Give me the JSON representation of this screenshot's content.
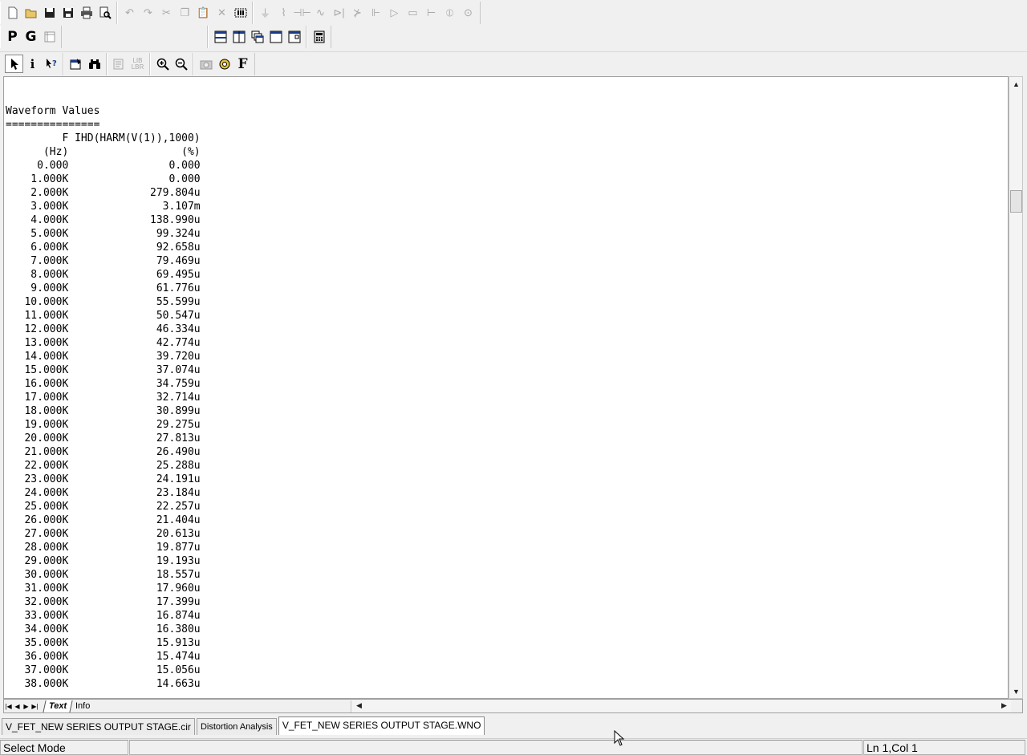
{
  "toolbar": {
    "chars": {
      "p_button": "P",
      "g_button": "G",
      "f_button": "F"
    }
  },
  "document": {
    "title_line": "Waveform Values",
    "underline": "===============",
    "header_row1": "         F IHD(HARM(V(1)),1000)",
    "header_row2": "      (Hz)                  (%)",
    "rows": [
      {
        "f": "0.000",
        "v": "0.000"
      },
      {
        "f": "1.000K",
        "v": "0.000"
      },
      {
        "f": "2.000K",
        "v": "279.804u"
      },
      {
        "f": "3.000K",
        "v": "3.107m"
      },
      {
        "f": "4.000K",
        "v": "138.990u"
      },
      {
        "f": "5.000K",
        "v": "99.324u"
      },
      {
        "f": "6.000K",
        "v": "92.658u"
      },
      {
        "f": "7.000K",
        "v": "79.469u"
      },
      {
        "f": "8.000K",
        "v": "69.495u"
      },
      {
        "f": "9.000K",
        "v": "61.776u"
      },
      {
        "f": "10.000K",
        "v": "55.599u"
      },
      {
        "f": "11.000K",
        "v": "50.547u"
      },
      {
        "f": "12.000K",
        "v": "46.334u"
      },
      {
        "f": "13.000K",
        "v": "42.774u"
      },
      {
        "f": "14.000K",
        "v": "39.720u"
      },
      {
        "f": "15.000K",
        "v": "37.074u"
      },
      {
        "f": "16.000K",
        "v": "34.759u"
      },
      {
        "f": "17.000K",
        "v": "32.714u"
      },
      {
        "f": "18.000K",
        "v": "30.899u"
      },
      {
        "f": "19.000K",
        "v": "29.275u"
      },
      {
        "f": "20.000K",
        "v": "27.813u"
      },
      {
        "f": "21.000K",
        "v": "26.490u"
      },
      {
        "f": "22.000K",
        "v": "25.288u"
      },
      {
        "f": "23.000K",
        "v": "24.191u"
      },
      {
        "f": "24.000K",
        "v": "23.184u"
      },
      {
        "f": "25.000K",
        "v": "22.257u"
      },
      {
        "f": "26.000K",
        "v": "21.404u"
      },
      {
        "f": "27.000K",
        "v": "20.613u"
      },
      {
        "f": "28.000K",
        "v": "19.877u"
      },
      {
        "f": "29.000K",
        "v": "19.193u"
      },
      {
        "f": "30.000K",
        "v": "18.557u"
      },
      {
        "f": "31.000K",
        "v": "17.960u"
      },
      {
        "f": "32.000K",
        "v": "17.399u"
      },
      {
        "f": "33.000K",
        "v": "16.874u"
      },
      {
        "f": "34.000K",
        "v": "16.380u"
      },
      {
        "f": "35.000K",
        "v": "15.913u"
      },
      {
        "f": "36.000K",
        "v": "15.474u"
      },
      {
        "f": "37.000K",
        "v": "15.056u"
      },
      {
        "f": "38.000K",
        "v": "14.663u"
      }
    ]
  },
  "sheet_tabs": [
    {
      "label": "Text",
      "active": true
    },
    {
      "label": "Info",
      "active": false
    }
  ],
  "doc_tabs": [
    {
      "label": "V_FET_NEW SERIES OUTPUT STAGE.cir",
      "active": false
    },
    {
      "label": "Distortion Analysis",
      "active": false
    },
    {
      "label": "V_FET_NEW SERIES OUTPUT STAGE.WNO",
      "active": true
    }
  ],
  "status": {
    "mode": "Select Mode",
    "middle": "",
    "position": "Ln 1,Col 1"
  }
}
